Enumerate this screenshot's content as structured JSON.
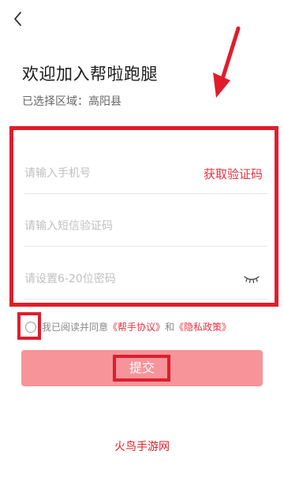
{
  "header": {
    "back_icon": "chevron-left-icon",
    "title": "欢迎加入帮啦跑腿",
    "region_text": "已选择区域：高阳县"
  },
  "form": {
    "phone_placeholder": "请输入手机号",
    "get_code_label": "获取验证码",
    "sms_placeholder": "请输入短信验证码",
    "password_placeholder": "请设置6-20位密码",
    "eye_icon": "eye-closed-icon"
  },
  "agreement": {
    "prefix": "我已阅读并同意",
    "helper_agreement": "《帮手协议》",
    "and": "和",
    "privacy_policy": "《隐私政策》",
    "checked": false
  },
  "submit_label": "提交",
  "watermark": "火鸟手游网",
  "colors": {
    "accent": "#e8313f",
    "annotation": "#e01d2a",
    "submit_bg": "#f7949a"
  }
}
